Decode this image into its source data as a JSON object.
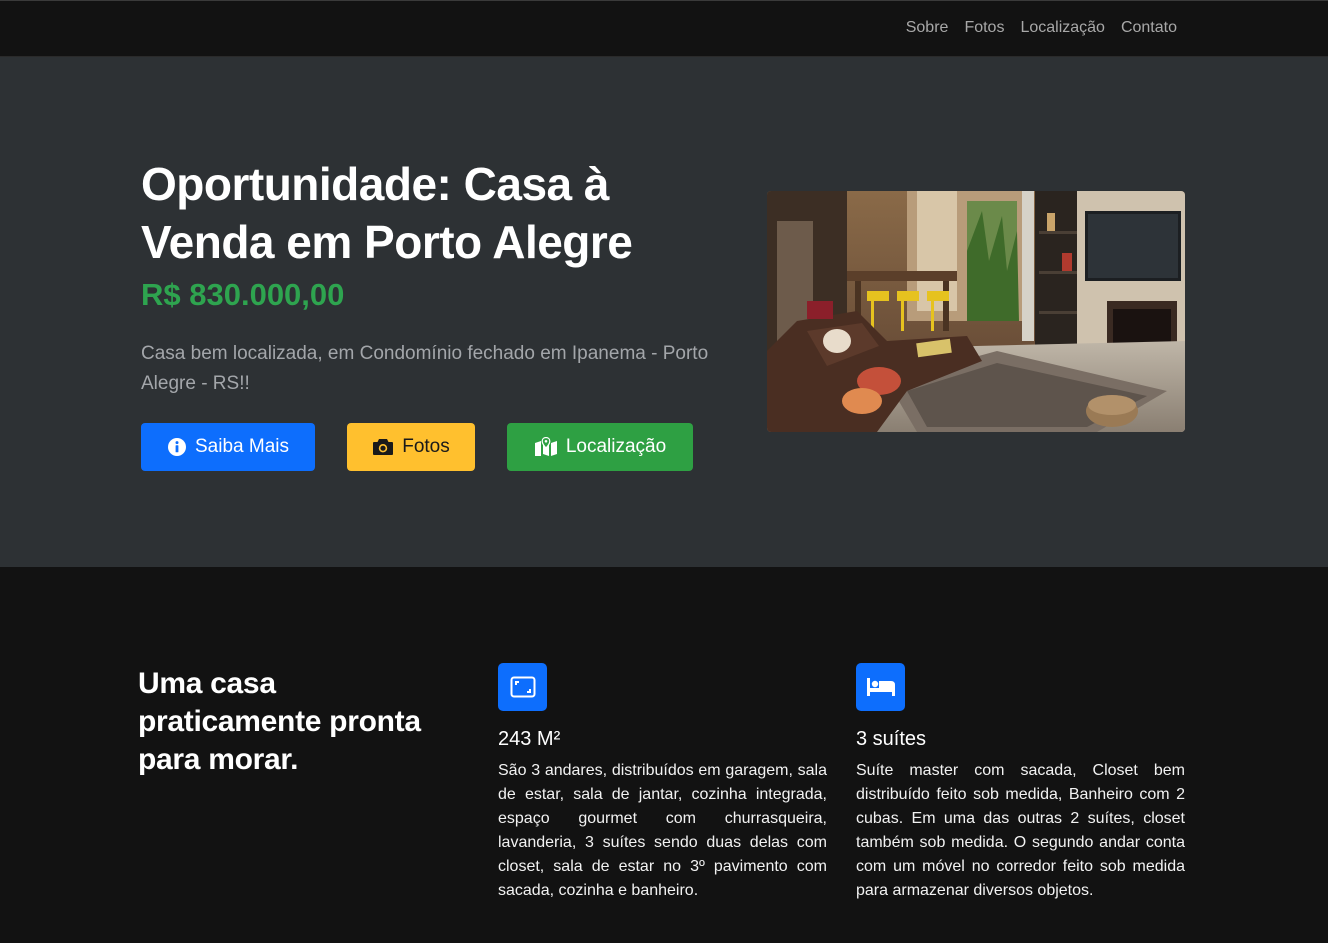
{
  "nav": {
    "items": [
      "Sobre",
      "Fotos",
      "Localização",
      "Contato"
    ]
  },
  "hero": {
    "title": "Oportunidade: Casa à Venda em Porto Alegre",
    "price": "R$ 830.000,00",
    "description": "Casa bem localizada, em Condomínio fechado em Ipanema - Porto Alegre - RS!!",
    "buttons": {
      "more": "Saiba Mais",
      "photos": "Fotos",
      "location": "Localização"
    },
    "photo_alt": "living-room-photo"
  },
  "features": {
    "title": "Uma casa praticamente pronta para morar.",
    "items": [
      {
        "icon": "area-icon",
        "heading": "243 M²",
        "text": "São 3 andares, distribuídos em garagem, sala de estar, sala de jantar, cozinha integrada, espaço gourmet com churrasqueira, lavanderia, 3 suítes sendo duas delas com closet, sala de estar no 3º pavimento com sacada, cozinha e banheiro."
      },
      {
        "icon": "bed-icon",
        "heading": "3 suítes",
        "text": "Suíte master com sacada, Closet bem distribuído feito sob medida, Banheiro com 2 cubas. Em uma das outras 2 suítes, closet também sob medida. O segundo andar conta com um móvel no corredor feito sob medida para armazenar diversos objetos."
      }
    ]
  },
  "colors": {
    "primary": "#0d6efd",
    "warning": "#ffc02e",
    "success": "#2ea043",
    "price": "#2ea44f",
    "hero_bg": "#2d3134",
    "page_bg": "#121212"
  }
}
